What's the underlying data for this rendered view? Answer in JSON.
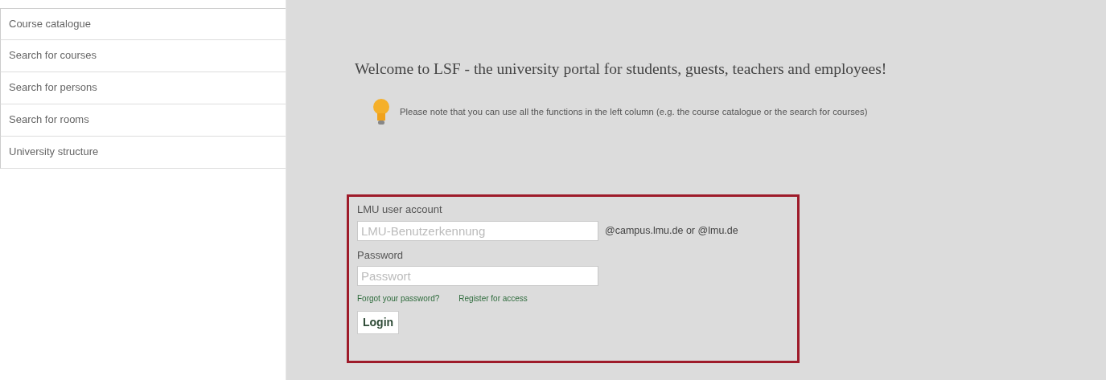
{
  "sidebar": {
    "items": [
      {
        "label": "Course catalogue"
      },
      {
        "label": "Search for courses"
      },
      {
        "label": "Search for persons"
      },
      {
        "label": "Search for rooms"
      },
      {
        "label": "University structure"
      }
    ]
  },
  "welcome": "Welcome to LSF - the university portal for students, guests, teachers and employees!",
  "notice": "Please note that you can use all the functions in the left column (e.g. the course catalogue or the search for courses)",
  "login": {
    "account_label": "LMU user account",
    "account_placeholder": "LMU-Benutzerkennung",
    "domain_hint": "@campus.lmu.de or @lmu.de",
    "password_label": "Password",
    "password_placeholder": "Passwort",
    "links": [
      "Forgot your password?",
      "Register for access"
    ],
    "button": "Login"
  }
}
